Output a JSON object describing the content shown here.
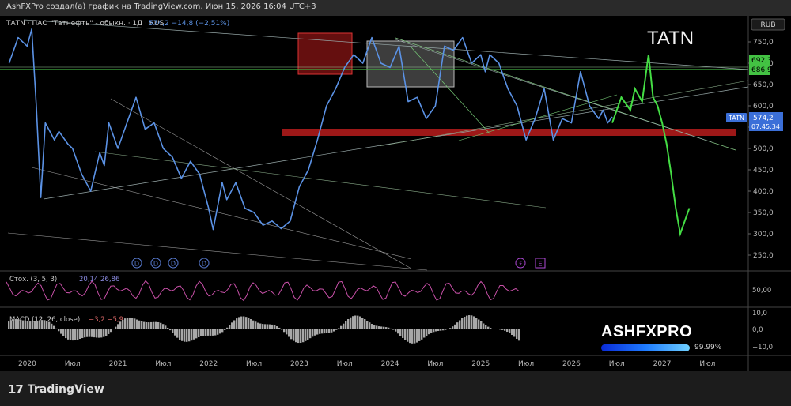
{
  "header": {
    "attribution": "AshFXPro создал(а) график на TradingView.com, Июн 15, 2026 16:04 UTC+3"
  },
  "chart_data": {
    "type": "line",
    "symbol_label": "TATN",
    "instrument": "ТАТN · ПАО \"Татнефть\" - обыкн. · 1Д · RUS",
    "quote": "574,2  −14,8 (−2,51%)",
    "watermark": "TATN",
    "currency": "RUB",
    "ylim": [
      225,
      785
    ],
    "y_ticks": [
      "750,0",
      "700,0",
      "650,0",
      "600,0",
      "550,0",
      "500,0",
      "450,0",
      "400,0",
      "350,0",
      "300,0",
      "250,0"
    ],
    "x_labels": [
      "2020",
      "Июл",
      "2021",
      "Июл",
      "2022",
      "Июл",
      "2023",
      "Июл",
      "2024",
      "Июл",
      "2025",
      "Июл",
      "2026",
      "Июл",
      "2027",
      "Июл"
    ],
    "price_badges": [
      {
        "label": "692,3",
        "color": "#43c243"
      },
      {
        "label": "686,9",
        "color": "#43c243"
      }
    ],
    "last_price": {
      "value": 574.2,
      "label": "574,2",
      "countdown": "07:45:34",
      "tag": "TATN",
      "color": "#3b6fd8"
    },
    "series": [
      {
        "color": "#5b92e5",
        "x": [
          2019.8,
          2019.9,
          2020.0,
          2020.05,
          2020.1,
          2020.15,
          2020.2,
          2020.3,
          2020.35,
          2020.45,
          2020.5,
          2020.6,
          2020.7,
          2020.8,
          2020.85,
          2020.9,
          2021.0,
          2021.1,
          2021.2,
          2021.3,
          2021.4,
          2021.5,
          2021.6,
          2021.7,
          2021.8,
          2021.9,
          2022.0,
          2022.05,
          2022.15,
          2022.2,
          2022.3,
          2022.4,
          2022.5,
          2022.6,
          2022.7,
          2022.8,
          2022.9,
          2023.0,
          2023.1,
          2023.2,
          2023.3,
          2023.4,
          2023.5,
          2023.6,
          2023.7,
          2023.8,
          2023.9,
          2024.0,
          2024.1,
          2024.2,
          2024.3,
          2024.4,
          2024.5,
          2024.6,
          2024.7,
          2024.8,
          2024.9,
          2025.0,
          2025.05,
          2025.1,
          2025.2,
          2025.3,
          2025.4,
          2025.5,
          2025.6,
          2025.7,
          2025.8,
          2025.9,
          2026.0,
          2026.1,
          2026.2,
          2026.3,
          2026.35,
          2026.4,
          2026.45
        ],
        "values": [
          700,
          760,
          740,
          780,
          600,
          385,
          560,
          520,
          540,
          510,
          500,
          440,
          400,
          490,
          460,
          560,
          500,
          560,
          620,
          545,
          560,
          500,
          480,
          430,
          470,
          440,
          360,
          310,
          420,
          380,
          420,
          360,
          350,
          320,
          330,
          312,
          330,
          410,
          450,
          520,
          600,
          640,
          690,
          720,
          700,
          760,
          700,
          690,
          740,
          610,
          620,
          570,
          600,
          740,
          730,
          760,
          700,
          720,
          680,
          720,
          700,
          640,
          600,
          520,
          570,
          640,
          520,
          570,
          560,
          680,
          600,
          570,
          590,
          560,
          574
        ]
      }
    ],
    "forecast_points": [
      {
        "x": 2026.45,
        "y": 560
      },
      {
        "x": 2026.55,
        "y": 620
      },
      {
        "x": 2026.65,
        "y": 590
      },
      {
        "x": 2026.7,
        "y": 640
      },
      {
        "x": 2026.78,
        "y": 610
      },
      {
        "x": 2026.85,
        "y": 720
      },
      {
        "x": 2026.9,
        "y": 620
      },
      {
        "x": 2026.95,
        "y": 600
      },
      {
        "x": 2027.0,
        "y": 560
      },
      {
        "x": 2027.05,
        "y": 510
      },
      {
        "x": 2027.1,
        "y": 440
      },
      {
        "x": 2027.15,
        "y": 360
      },
      {
        "x": 2027.2,
        "y": 300
      },
      {
        "x": 2027.25,
        "y": 330
      },
      {
        "x": 2027.3,
        "y": 360
      }
    ],
    "oscillators": [
      {
        "name": "Стох. (3, 5, 3)",
        "values_label": "20,14  26,86",
        "ticks": [
          "50,00"
        ]
      },
      {
        "name": "MACD (12, 26, close)",
        "values_label": "−3,2  −5,9",
        "ticks": [
          "10,0",
          "0,0",
          "−10,0"
        ]
      }
    ],
    "event_markers": [
      "D",
      "D",
      "D",
      "D",
      "⚡",
      "E"
    ]
  },
  "branding": {
    "tradingview": "TradingView",
    "tv_mark": "17",
    "badge": "ASHFXPRO",
    "badge_pct": "99.99%"
  }
}
